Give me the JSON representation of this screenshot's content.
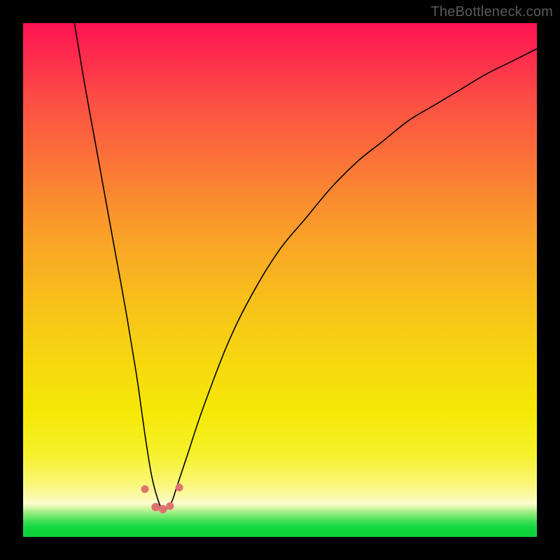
{
  "watermark": "TheBottleneck.com",
  "colors": {
    "frame": "#000000",
    "curve": "#000000",
    "marker": "#e0736f",
    "gradient_top": "#fd1453",
    "gradient_bottom": "#0dcf39"
  },
  "chart_data": {
    "type": "line",
    "title": "",
    "xlabel": "",
    "ylabel": "",
    "xlim": [
      0,
      100
    ],
    "ylim": [
      0,
      100
    ],
    "grid": false,
    "legend": false,
    "series": [
      {
        "name": "bottleneck-curve",
        "comment": "V-shaped curve: y≈100 at x≈10, drops to ≈5 around x≈27, rises back toward ~95 near x≈100. Values estimated from pixel positions.",
        "x": [
          10,
          12,
          14,
          16,
          18,
          20,
          22,
          23,
          24,
          25,
          26,
          27,
          28,
          29,
          30,
          32,
          35,
          40,
          45,
          50,
          55,
          60,
          65,
          70,
          75,
          80,
          85,
          90,
          95,
          100
        ],
        "y": [
          100,
          88,
          77,
          66,
          55,
          44,
          32,
          25,
          18,
          12,
          8,
          5.5,
          5.5,
          7,
          10,
          16,
          25,
          38,
          48,
          56,
          62,
          68,
          73,
          77,
          81,
          84,
          87,
          90,
          92.5,
          95
        ]
      }
    ],
    "markers": {
      "comment": "Small salmon dots near the trough / green band, estimated coordinates.",
      "points": [
        {
          "x": 23.7,
          "y": 9.3,
          "r": 5.5
        },
        {
          "x": 25.8,
          "y": 5.8,
          "r": 6.0
        },
        {
          "x": 27.2,
          "y": 5.4,
          "r": 6.0
        },
        {
          "x": 28.6,
          "y": 6.0,
          "r": 5.5
        },
        {
          "x": 30.4,
          "y": 9.6,
          "r": 5.5
        }
      ]
    }
  }
}
